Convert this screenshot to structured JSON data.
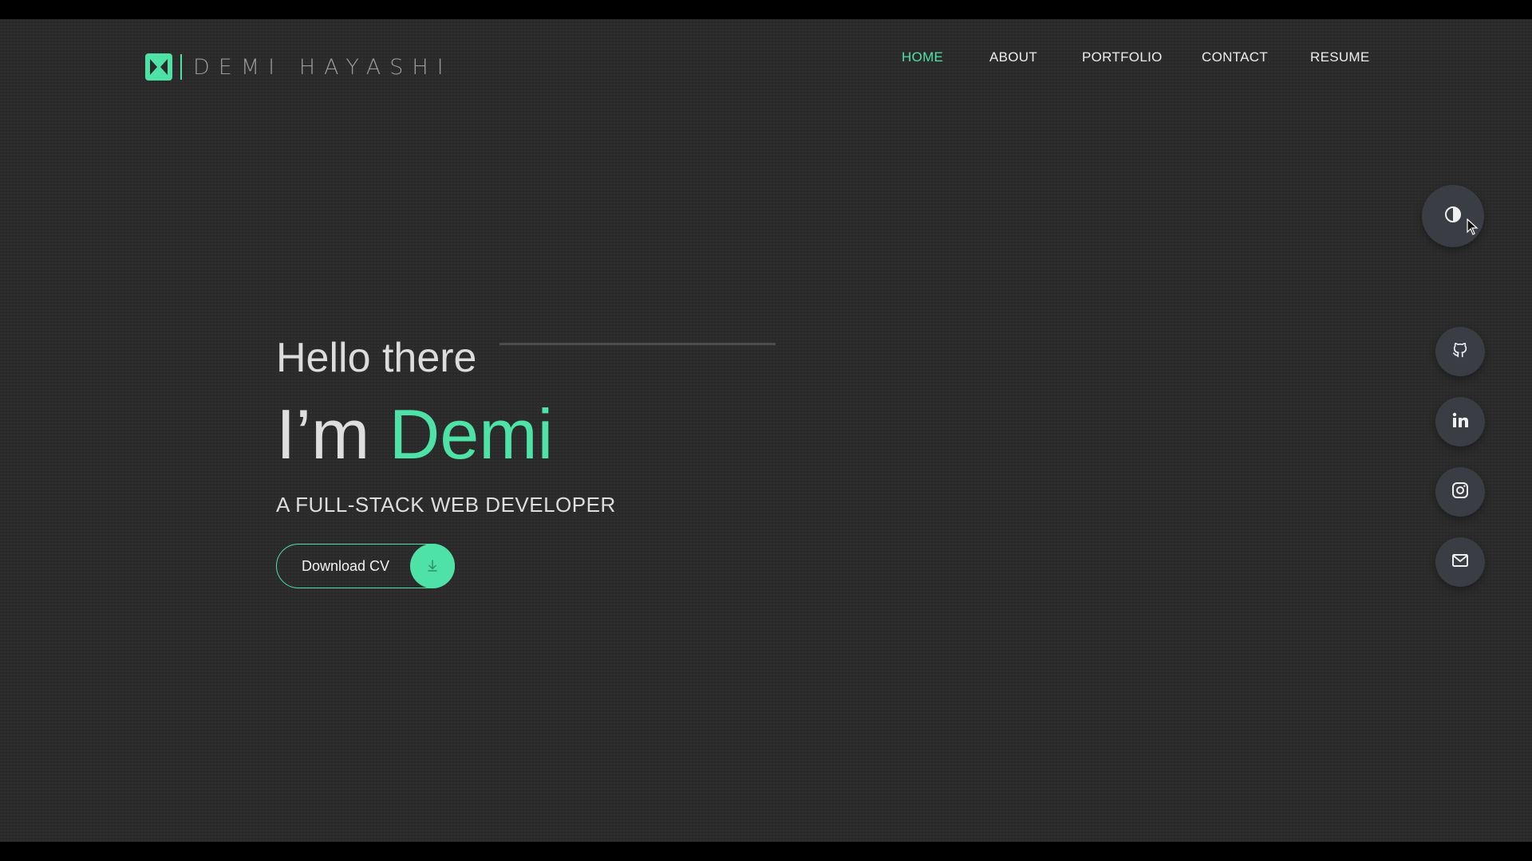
{
  "brand": {
    "name": "DEMI HAYASHI",
    "logo_letter_icon": "brand-logo-icon"
  },
  "nav": {
    "items": [
      {
        "label": "HOME",
        "active": true
      },
      {
        "label": "ABOUT",
        "active": false
      },
      {
        "label": "PORTFOLIO",
        "active": false
      },
      {
        "label": "CONTACT",
        "active": false
      },
      {
        "label": "RESUME",
        "active": false
      }
    ]
  },
  "hero": {
    "greeting": "Hello there",
    "intro_prefix": "I’m",
    "intro_name": "Demi",
    "role": "A FULL-STACK WEB DEVELOPER",
    "cv_button_label": "Download CV",
    "cv_button_icon": "download-icon"
  },
  "side": {
    "theme_toggle_icon": "contrast-icon",
    "socials": [
      {
        "name": "github",
        "icon": "github-icon"
      },
      {
        "name": "linkedin",
        "icon": "linkedin-icon"
      },
      {
        "name": "instagram",
        "icon": "instagram-icon"
      },
      {
        "name": "email",
        "icon": "mail-icon"
      }
    ]
  },
  "colors": {
    "accent": "#4ee2a6",
    "background": "#2a2a2a",
    "text": "#dedede"
  }
}
